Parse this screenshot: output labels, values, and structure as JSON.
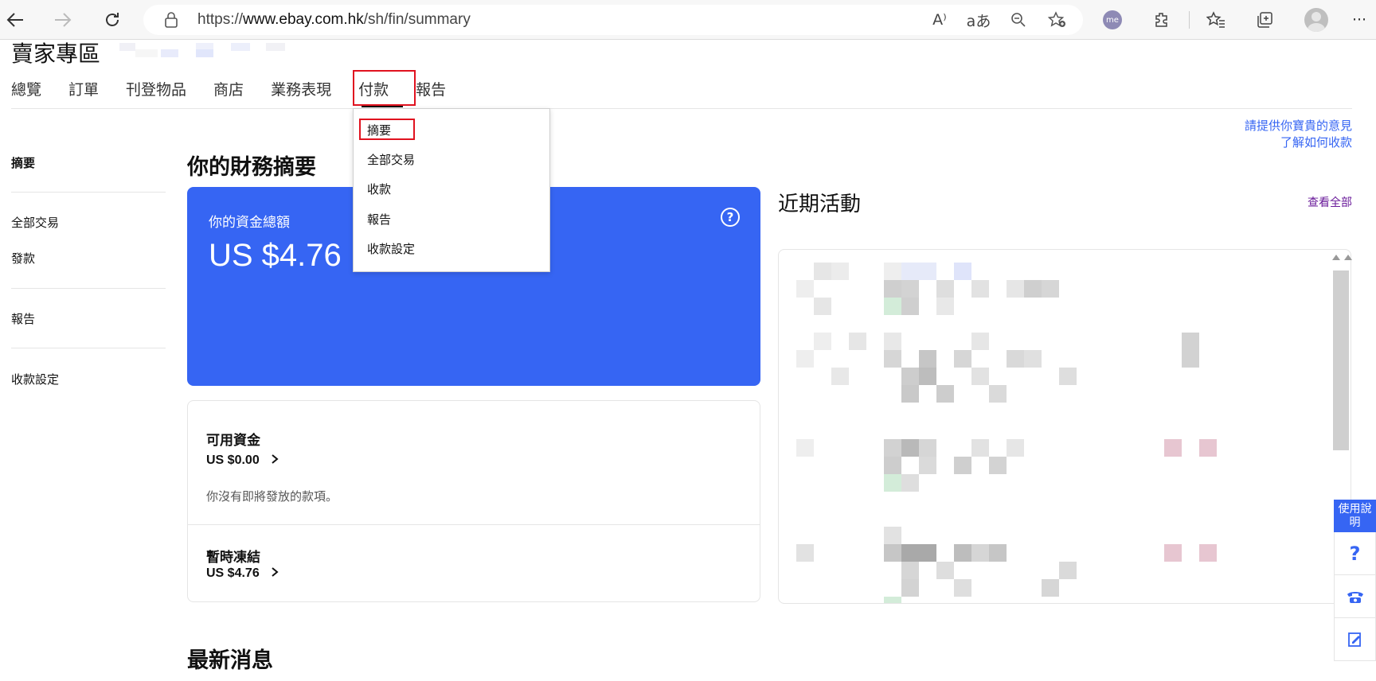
{
  "browser": {
    "url_prefix": "https://",
    "url_domain": "www.ebay.com.hk",
    "url_path": "/sh/fin/summary",
    "profile_badge": "me"
  },
  "header": {
    "title": "賣家專區"
  },
  "topnav": {
    "items": [
      {
        "label": "總覽"
      },
      {
        "label": "訂單"
      },
      {
        "label": "刊登物品"
      },
      {
        "label": "商店"
      },
      {
        "label": "業務表現"
      },
      {
        "label": "付款"
      },
      {
        "label": "報告"
      }
    ]
  },
  "dropdown": {
    "items": [
      {
        "label": "摘要"
      },
      {
        "label": "全部交易"
      },
      {
        "label": "收款"
      },
      {
        "label": "報告"
      },
      {
        "label": "收款設定"
      }
    ]
  },
  "links": {
    "feedback": "請提供你寶貴的意見",
    "learn": "了解如何收款"
  },
  "sidebar": {
    "items": [
      {
        "label": "摘要"
      },
      {
        "label": "全部交易"
      },
      {
        "label": "發款"
      },
      {
        "label": "報告"
      },
      {
        "label": "收款設定"
      }
    ]
  },
  "main": {
    "heading": "你的財務摘要",
    "total_label": "你的資金總額",
    "total_amount": "US $4.76",
    "help_symbol": "?",
    "available_title": "可用資金",
    "available_amount": "US $0.00",
    "available_note": "你沒有即將發放的款項。",
    "frozen_title": "暫時凍結",
    "frozen_amount": "US $4.76",
    "news_heading": "最新消息"
  },
  "activity": {
    "heading": "近期活動",
    "view_all": "查看全部"
  },
  "help_widget": {
    "title": "使用說明",
    "question_symbol": "?"
  },
  "colors": {
    "accent": "#3665f3",
    "highlight_box": "#e0121f",
    "view_all": "#6a1b9a"
  }
}
